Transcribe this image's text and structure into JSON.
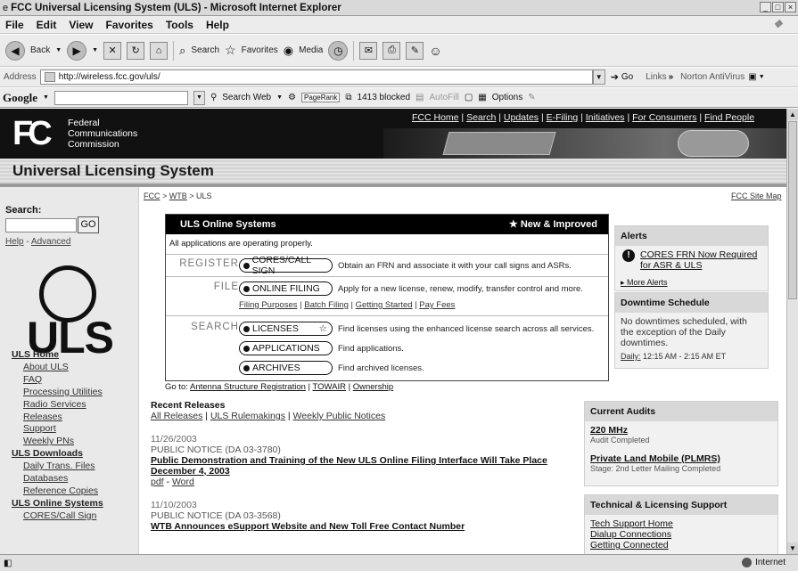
{
  "window": {
    "title": "FCC Universal Licensing System (ULS) - Microsoft Internet Explorer"
  },
  "menu": [
    "File",
    "Edit",
    "View",
    "Favorites",
    "Tools",
    "Help"
  ],
  "toolbar": {
    "back": "Back",
    "search": "Search",
    "favorites": "Favorites",
    "media": "Media"
  },
  "addressbar": {
    "label": "Address",
    "url": "http://wireless.fcc.gov/uls/",
    "go": "Go",
    "links": "Links",
    "antivirus": "Norton AntiVirus"
  },
  "googlebar": {
    "logo": "Google",
    "search_web": "Search Web",
    "blocked": "1413 blocked",
    "autofill": "AutoFill",
    "options": "Options",
    "pagerank": "PageRank"
  },
  "fcc": {
    "logo": "FC",
    "name_line1": "Federal",
    "name_line2": "Communications",
    "name_line3": "Commission",
    "topnav": [
      "FCC Home",
      "Search",
      "Updates",
      "E-Filing",
      "Initiatives",
      "For Consumers",
      "Find People"
    ]
  },
  "banner_title": "Universal Licensing System",
  "breadcrumb": [
    "FCC",
    "WTB",
    "ULS"
  ],
  "sitemap": "FCC Site Map",
  "left": {
    "search_label": "Search:",
    "go": "GO",
    "help": "Help",
    "advanced": "Advanced",
    "logo_text": "ULS",
    "nav": [
      {
        "type": "grp",
        "label": "ULS Home"
      },
      {
        "type": "item",
        "label": "About ULS"
      },
      {
        "type": "item",
        "label": "FAQ"
      },
      {
        "type": "item",
        "label": "Processing Utilities"
      },
      {
        "type": "item",
        "label": "Radio Services"
      },
      {
        "type": "item",
        "label": "Releases"
      },
      {
        "type": "item",
        "label": "Support"
      },
      {
        "type": "item",
        "label": "Weekly PNs"
      },
      {
        "type": "grp",
        "label": "ULS Downloads"
      },
      {
        "type": "item",
        "label": "Daily Trans. Files"
      },
      {
        "type": "item",
        "label": "Databases"
      },
      {
        "type": "item",
        "label": "Reference Copies"
      },
      {
        "type": "grp",
        "label": "ULS Online Systems"
      },
      {
        "type": "item",
        "label": "CORES/Call Sign"
      }
    ]
  },
  "online": {
    "title": "ULS Online Systems",
    "new": "New & Improved",
    "status": "All applications are operating properly.",
    "register_label": "REGISTER",
    "cores_btn": "CORES/CALL SIGN",
    "cores_desc": "Obtain an FRN and associate it with your call signs and ASRs.",
    "file_label": "FILE",
    "filing_btn": "ONLINE FILING",
    "filing_desc": "Apply for a new license, renew, modify, transfer control and more.",
    "file_links": [
      "Filing Purposes",
      "Batch Filing",
      "Getting Started",
      "Pay Fees"
    ],
    "search_label": "SEARCH",
    "licenses_btn": "LICENSES",
    "licenses_desc": "Find licenses using the enhanced license search across all services.",
    "apps_btn": "APPLICATIONS",
    "apps_desc": "Find applications.",
    "archives_btn": "ARCHIVES",
    "archives_desc": "Find archived licenses.",
    "goto_label": "Go to:",
    "goto_links": [
      "Antenna Structure Registration",
      "TOWAIR",
      "Ownership"
    ]
  },
  "alerts": {
    "title": "Alerts",
    "alert_text": "CORES FRN Now Required for ASR & ULS",
    "more": "More Alerts"
  },
  "downtime": {
    "title": "Downtime Schedule",
    "body": "No downtimes scheduled, with the exception of the Daily downtimes.",
    "daily_label": "Daily:",
    "daily_time": "12:15 AM - 2:15 AM ET"
  },
  "releases": {
    "title": "Recent Releases",
    "links": [
      "All Releases",
      "ULS Rulemakings",
      "Weekly Public Notices"
    ],
    "items": [
      {
        "date": "11/26/2003",
        "notice": "PUBLIC NOTICE (DA 03-3780)",
        "title": "Public Demonstration and Training of the New ULS Online Filing Interface Will Take Place December 4, 2003",
        "formats": [
          "pdf",
          "Word"
        ]
      },
      {
        "date": "11/10/2003",
        "notice": "PUBLIC NOTICE (DA 03-3568)",
        "title": "WTB Announces eSupport Website and New Toll Free Contact Number"
      }
    ]
  },
  "audits": {
    "title": "Current Audits",
    "items": [
      {
        "name": "220 MHz",
        "status": "Audit Completed"
      },
      {
        "name": "Private Land Mobile (PLMRS)",
        "status": "Stage: 2nd Letter Mailing Completed"
      }
    ]
  },
  "techsupport": {
    "title": "Technical & Licensing Support",
    "links": [
      "Tech Support Home",
      "Dialup Connections",
      "Getting Connected"
    ]
  },
  "statusbar": {
    "zone": "Internet"
  }
}
